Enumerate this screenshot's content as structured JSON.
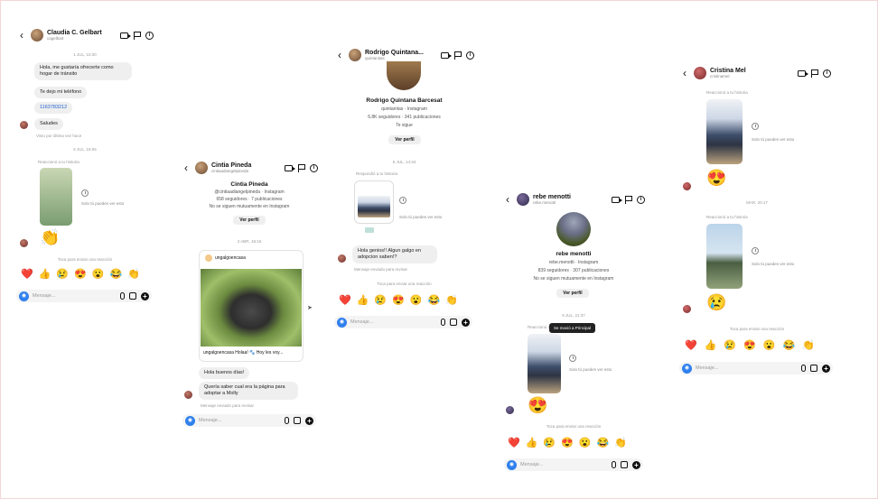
{
  "panels": {
    "claudia": {
      "name": "Claudia C. Gelbart",
      "handle": "cagelbart",
      "date1": "1 JUL, 10:30",
      "msg1": "Hola, me gustaría ofrecerte como hogar de tránsito",
      "msg2": "Te dejo mi teléfono",
      "msg3": "1163783212",
      "msg4": "Saludes",
      "seen": "Visto por última vez hace",
      "date2": "6 JUL, 16:06",
      "reacted": "Reaccionó a tu historia",
      "story_note": "Solo tú puedes ver esto",
      "reaction_emoji": "👏",
      "cta": "Toca para enviar una reacción",
      "emojis": [
        "❤️",
        "👍",
        "😢",
        "😍",
        "😮",
        "😂",
        "👏"
      ],
      "placeholder": "Mensaje..."
    },
    "cintia": {
      "name": "Cintia Pineda",
      "handle": "cintiaadiangelpineda",
      "profile_name": "Cintia Pineda",
      "profile_line1": "@cintiaadiangelpineda · Instagram",
      "profile_line2": "658 seguidores · 7 publicaciones",
      "profile_line3": "No se siguen mutuamente en Instagram",
      "view_profile": "Ver perfil",
      "date": "2 ABR, 16:16",
      "post_user": "ungalgoencasa",
      "post_caption": "ungalgoencasa Holaa! 🐾 Hoy les voy...",
      "msg1": "Hola buenos días!",
      "msg2": "Quería saber cual era la página para adoptar a Molly",
      "seen": "Mensaje enviado para revisar",
      "placeholder": "Mensaje..."
    },
    "rodrigo": {
      "name": "Rodrigo Quintana...",
      "handle": "quintanitas",
      "profile_name": "Rodrigo Quintana Barcesat",
      "profile_line1": "quintanitas · Instagram",
      "profile_line2": "6.8K seguidores · 341 publicaciones",
      "profile_line3": "Te sigue",
      "view_profile": "Ver perfil",
      "date": "5 JUL, 14:34",
      "replied": "Respondió a tu historia",
      "story_note": "Solo tú puedes ver esto",
      "msg1": "Hola genios!! Algun galgo en adopcion saben!?",
      "seen": "Mensaje enviado para revisar",
      "cta": "Toca para enviar una reacción",
      "emojis": [
        "❤️",
        "👍",
        "😢",
        "😍",
        "😮",
        "😂",
        "👏"
      ],
      "placeholder": "Mensaje..."
    },
    "rebe": {
      "name": "rebe menotti",
      "handle": "rebe.menotti",
      "profile_name": "rebe menotti",
      "profile_line1": "rebe.menotti · Instagram",
      "profile_line2": "839 seguidores · 307 publicaciones",
      "profile_line3": "No se siguen mutuamente en Instagram",
      "view_profile": "Ver perfil",
      "date": "9 JUL, 21:37",
      "reacted": "Reaccionó a tu historia",
      "tooltip": "Se movió a Principal",
      "story_note": "Solo tú puedes ver esto",
      "reaction_emoji": "😍",
      "cta": "Toca para enviar una reacción",
      "emojis": [
        "❤️",
        "👍",
        "😢",
        "😍",
        "😮",
        "😂",
        "👏"
      ],
      "placeholder": "Mensaje..."
    },
    "cristina": {
      "name": "Cristina Mel",
      "handle": "cristinamel",
      "reacted1": "Reaccionó a tu historia",
      "story_note": "Solo tú puedes ver esto",
      "reaction1": "😍",
      "date": "MAR, 20:17",
      "reacted2": "Reaccionó a tu historia",
      "reaction2": "😢",
      "cta": "Toca para enviar una reacción",
      "emojis": [
        "❤️",
        "👍",
        "😢",
        "😍",
        "😮",
        "😂",
        "👏"
      ],
      "placeholder": "Mensaje..."
    }
  },
  "colors": {
    "accent": "#2f80ed",
    "bubble": "#efefef"
  }
}
